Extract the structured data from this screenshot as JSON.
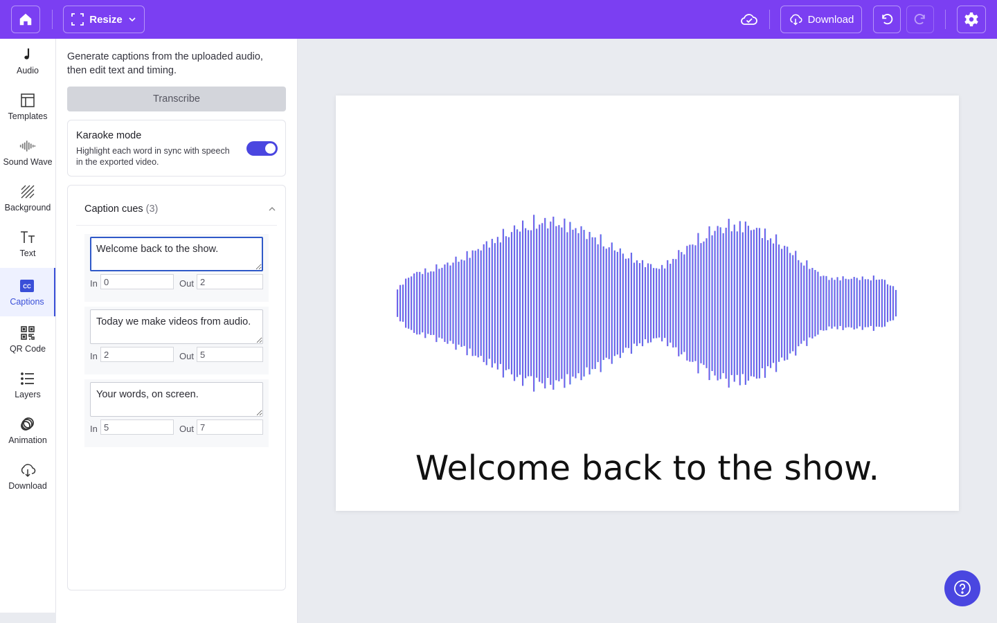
{
  "topbar": {
    "resize_label": "Resize",
    "download_label": "Download",
    "icons": [
      "home-icon",
      "resize-icon",
      "chevron-down-icon",
      "cloud-icon",
      "download-icon",
      "undo-icon",
      "redo-icon",
      "gear-icon"
    ]
  },
  "rail": {
    "items": [
      {
        "label": "Audio",
        "icon": "music-note-icon"
      },
      {
        "label": "Templates",
        "icon": "templates-icon"
      },
      {
        "label": "Sound Wave",
        "icon": "sound-wave-icon"
      },
      {
        "label": "Background",
        "icon": "background-icon"
      },
      {
        "label": "Text",
        "icon": "text-icon"
      },
      {
        "label": "Captions",
        "icon": "captions-icon",
        "active": true
      },
      {
        "label": "QR Code",
        "icon": "qr-code-icon"
      },
      {
        "label": "Layers",
        "icon": "layers-icon"
      },
      {
        "label": "Animation",
        "icon": "animation-icon"
      },
      {
        "label": "Download",
        "icon": "download-icon"
      }
    ]
  },
  "panel": {
    "intro": "Generate captions from the uploaded audio, then edit text and timing.",
    "transcribe_label": "Transcribe",
    "karaoke": {
      "title": "Karaoke mode",
      "description": "Highlight each word in sync with speech in the exported video.",
      "enabled": true
    },
    "cues": {
      "title": "Caption cues",
      "count": "(3)",
      "in_label": "In",
      "out_label": "Out",
      "items": [
        {
          "text": "Welcome back to the show.",
          "in": "0",
          "out": "2"
        },
        {
          "text": "Today we make videos from audio.",
          "in": "2",
          "out": "5"
        },
        {
          "text": "Your words, on screen.",
          "in": "5",
          "out": "7"
        }
      ]
    }
  },
  "canvas": {
    "caption": "Welcome back to the show.",
    "wave_gradient": [
      "#8a2be2",
      "#4aa8f0"
    ]
  },
  "colors": {
    "topbar": "#7b3ff2",
    "accent": "#4a46e0",
    "active_nav": "#3a4fd8"
  }
}
